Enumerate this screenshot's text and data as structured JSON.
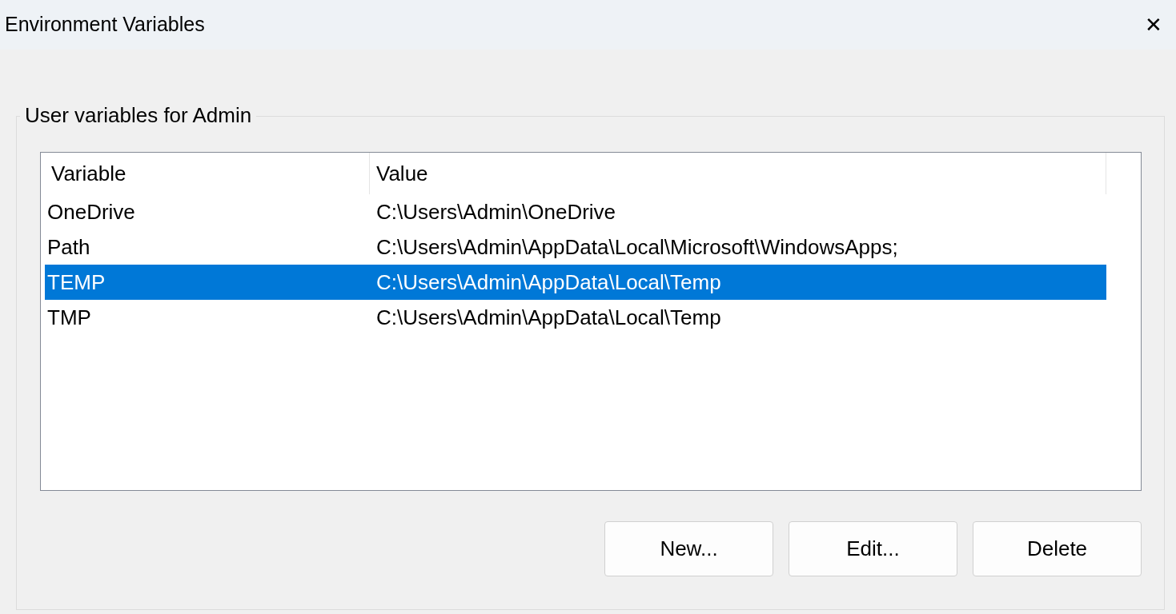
{
  "window": {
    "title": "Environment Variables",
    "close": "✕"
  },
  "group": {
    "label": "User variables for Admin"
  },
  "table": {
    "columns": [
      "Variable",
      "Value"
    ],
    "rows": [
      {
        "variable": "OneDrive",
        "value": "C:\\Users\\Admin\\OneDrive",
        "selected": false
      },
      {
        "variable": "Path",
        "value": "C:\\Users\\Admin\\AppData\\Local\\Microsoft\\WindowsApps;",
        "selected": false
      },
      {
        "variable": "TEMP",
        "value": "C:\\Users\\Admin\\AppData\\Local\\Temp",
        "selected": true
      },
      {
        "variable": "TMP",
        "value": "C:\\Users\\Admin\\AppData\\Local\\Temp",
        "selected": false
      }
    ]
  },
  "buttons": [
    "New...",
    "Edit...",
    "Delete"
  ]
}
